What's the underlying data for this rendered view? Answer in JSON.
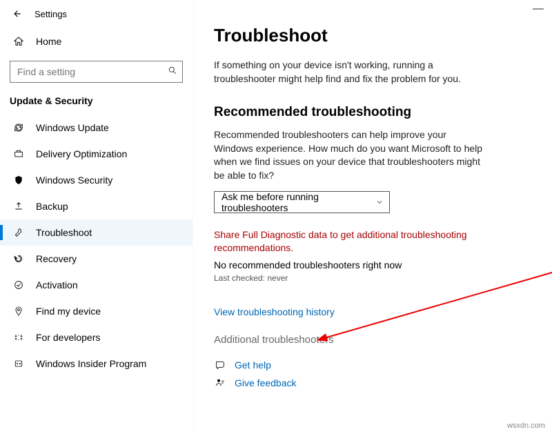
{
  "app_title": "Settings",
  "home_label": "Home",
  "search_placeholder": "Find a setting",
  "section_title": "Update & Security",
  "sidebar": [
    {
      "label": "Windows Update"
    },
    {
      "label": "Delivery Optimization"
    },
    {
      "label": "Windows Security"
    },
    {
      "label": "Backup"
    },
    {
      "label": "Troubleshoot"
    },
    {
      "label": "Recovery"
    },
    {
      "label": "Activation"
    },
    {
      "label": "Find my device"
    },
    {
      "label": "For developers"
    },
    {
      "label": "Windows Insider Program"
    }
  ],
  "page": {
    "title": "Troubleshoot",
    "intro": "If something on your device isn't working, running a troubleshooter might help find and fix the problem for you.",
    "recommended_heading": "Recommended troubleshooting",
    "recommended_text": "Recommended troubleshooters can help improve your Windows experience. How much do you want Microsoft to help when we find issues on your device that troubleshooters might be able to fix?",
    "dropdown_value": "Ask me before running troubleshooters",
    "diagnostic_warning": "Share Full Diagnostic data to get additional troubleshooting recommendations.",
    "no_recommended": "No recommended troubleshooters right now",
    "last_checked": "Last checked: never",
    "history_link": "View troubleshooting history",
    "additional_label": "Additional troubleshooters",
    "get_help": "Get help",
    "give_feedback": "Give feedback"
  },
  "watermark": "wsxdn.com"
}
